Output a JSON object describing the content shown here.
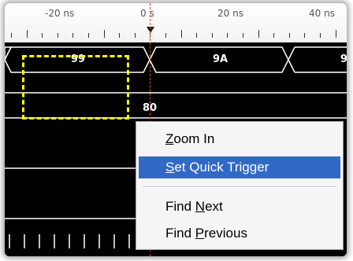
{
  "ruler": {
    "labels": [
      "-20 ns",
      "0 s",
      "20 ns",
      "40 ns"
    ]
  },
  "bus": {
    "values": [
      "99",
      "9A",
      "9"
    ]
  },
  "cursor": {
    "value": "80",
    "color": "#ff3b3b"
  },
  "selection": {
    "color": "#ffff00"
  },
  "context_menu": {
    "items": [
      {
        "label": "Zoom In",
        "hotkey": "Z"
      },
      {
        "label": "Set Quick Trigger",
        "hotkey": "S"
      },
      {
        "label": "Find Next",
        "hotkey": "N"
      },
      {
        "label": "Find Previous",
        "hotkey": "P"
      }
    ],
    "highlight_color": "#3169c6"
  }
}
